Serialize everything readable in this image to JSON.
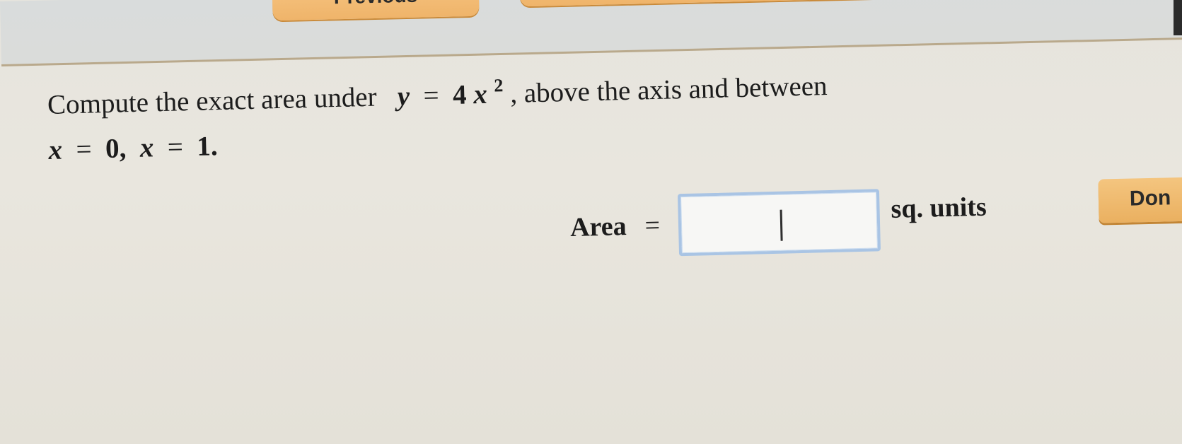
{
  "nav": {
    "previous_label": "Previous",
    "next_label": ""
  },
  "question": {
    "prefix": "Compute the exact area under",
    "var_y": "y",
    "equals": "=",
    "coef": "4",
    "var_x": "x",
    "exponent": "2",
    "middle": ", above the axis and between",
    "line2_x1": "x",
    "line2_eq1": "=",
    "line2_v1": "0,",
    "line2_x2": "x",
    "line2_eq2": "=",
    "line2_v2": "1."
  },
  "answer": {
    "label": "Area",
    "equals": "=",
    "value": "",
    "units": "sq. units"
  },
  "done_label": "Don",
  "colors": {
    "button": "#efb46a",
    "input_border": "#a9c4e4",
    "background": "#e6e4dd"
  }
}
